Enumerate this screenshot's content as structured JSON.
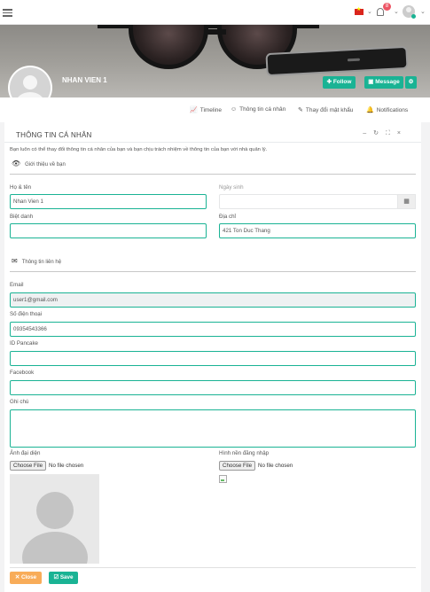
{
  "topbar": {
    "notification_count": "8"
  },
  "profile": {
    "name": "NHAN VIEN 1",
    "follow_label": "Follow",
    "message_label": "Message"
  },
  "tabs": [
    {
      "label": "Timeline",
      "icon": "chart-line-icon"
    },
    {
      "label": "Thông tin cá nhân",
      "icon": "user-icon"
    },
    {
      "label": "Thay đổi mật khẩu",
      "icon": "edit-icon"
    },
    {
      "label": "Notifications",
      "icon": "bell-icon"
    }
  ],
  "card": {
    "title": "THÔNG TIN CÁ NHÂN",
    "description": "Bạn luôn có thể thay đổi thông tin cá nhân của bạn và bạn chịu trách nhiệm về thông tin của bạn với nhà quản lý.",
    "section_intro": "Giới thiệu về bạn",
    "section_contact": "Thông tin liên hệ"
  },
  "form": {
    "fullname_label": "Họ & tên",
    "fullname_value": "Nhan Vien 1",
    "dob_label": "Ngày sinh",
    "dob_value": "",
    "nickname_label": "Biệt danh",
    "nickname_value": "",
    "address_label": "Địa chỉ",
    "address_value": "421 Ton Duc Thang",
    "email_label": "Email",
    "email_value": "user1@gmail.com",
    "phone_label": "Số điện thoại",
    "phone_value": "09354543366",
    "pancake_label": "ID Pancake",
    "pancake_value": "",
    "facebook_label": "Facebook",
    "facebook_value": "",
    "note_label": "Ghi chú",
    "avatar_label": "Ảnh đại diện",
    "login_bg_label": "Hình nền đăng nhập",
    "choose_file": "Choose File",
    "no_file": "No file chosen"
  },
  "actions": {
    "close_label": "Close",
    "save_label": "Save"
  },
  "colors": {
    "accent": "#1ab394",
    "danger": "#f8ac59",
    "badge": "#ed5565"
  }
}
